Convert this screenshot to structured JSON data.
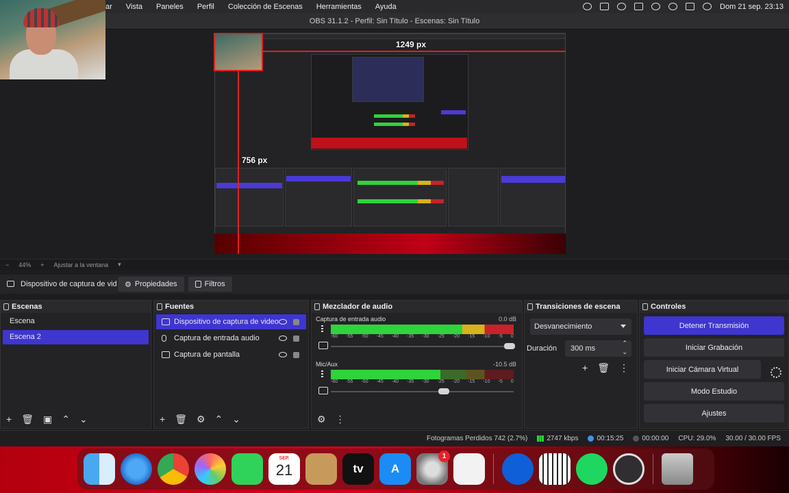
{
  "menubar": {
    "items": [
      "ar",
      "Vista",
      "Paneles",
      "Perfil",
      "Colección de Escenas",
      "Herramientas",
      "Ayuda"
    ],
    "clock": "Dom 21 sep.  23:13"
  },
  "window": {
    "title": "OBS 31.1.2 - Perfil: Sin Título - Escenas: Sin Título"
  },
  "preview": {
    "width_label": "1249 px",
    "height_label": "756 px",
    "zoom": "44%",
    "fit_label": "Ajustar a la ventana"
  },
  "source_toolbar": {
    "source_name": "Dispositivo de captura de vid",
    "properties_label": "Propiedades",
    "filters_label": "Filtros"
  },
  "scenes": {
    "title": "Escenas",
    "items": [
      {
        "label": "Escena",
        "selected": false
      },
      {
        "label": "Escena 2",
        "selected": true
      }
    ]
  },
  "sources": {
    "title": "Fuentes",
    "items": [
      {
        "label": "Dispositivo de captura de video",
        "icon": "camera-icon",
        "selected": true
      },
      {
        "label": "Captura de entrada audio",
        "icon": "microphone-icon",
        "selected": false
      },
      {
        "label": "Captura de pantalla",
        "icon": "monitor-icon",
        "selected": false
      }
    ]
  },
  "mixer": {
    "title": "Mezclador de audio",
    "channels": [
      {
        "name": "Captura de entrada audio",
        "db": "0.0 dB",
        "level": 0.84,
        "volume": 1.0
      },
      {
        "name": "Mic/Aux",
        "db": "-10.5 dB",
        "level": 0.6,
        "volume": 0.62
      }
    ],
    "ticks": [
      "-60",
      "-55",
      "-50",
      "-45",
      "-40",
      "-35",
      "-30",
      "-25",
      "-20",
      "-15",
      "-10",
      "-5",
      "0"
    ]
  },
  "transitions": {
    "title": "Transiciones de escena",
    "selected": "Desvanecimiento",
    "duration_label": "Duración",
    "duration_value": "300 ms"
  },
  "controls": {
    "title": "Controles",
    "stop_stream": "Detener Transmisión",
    "start_recording": "Iniciar Grabación",
    "start_virtual_cam": "Iniciar Cámara Virtual",
    "studio_mode": "Modo Estudio",
    "settings": "Ajustes"
  },
  "status": {
    "dropped_frames": "Fotogramas Perdidos 742 (2.7%)",
    "bitrate": "2747 kbps",
    "stream_time": "00:15:25",
    "record_time": "00:00:00",
    "cpu": "CPU: 29.0%",
    "fps": "30.00 / 30.00 FPS"
  },
  "dock": {
    "calendar_month": "SEP.",
    "calendar_day": "21",
    "settings_badge": "1",
    "tv_label": "tv",
    "apps": [
      "Finder",
      "Safari",
      "Chrome",
      "Fotos",
      "FaceTime",
      "Calendario",
      "Contactos",
      "TV",
      "App Store",
      "Ajustes del Sistema",
      "Vista Previa",
      "TeamViewer",
      "Piano",
      "Spotify",
      "OBS",
      "Papelera"
    ]
  },
  "colors": {
    "accent": "#3f35d0",
    "meter_green": "#2fd33b",
    "meter_yellow": "#d6b21c",
    "meter_red": "#c8222a",
    "guide_red": "#e02020"
  }
}
